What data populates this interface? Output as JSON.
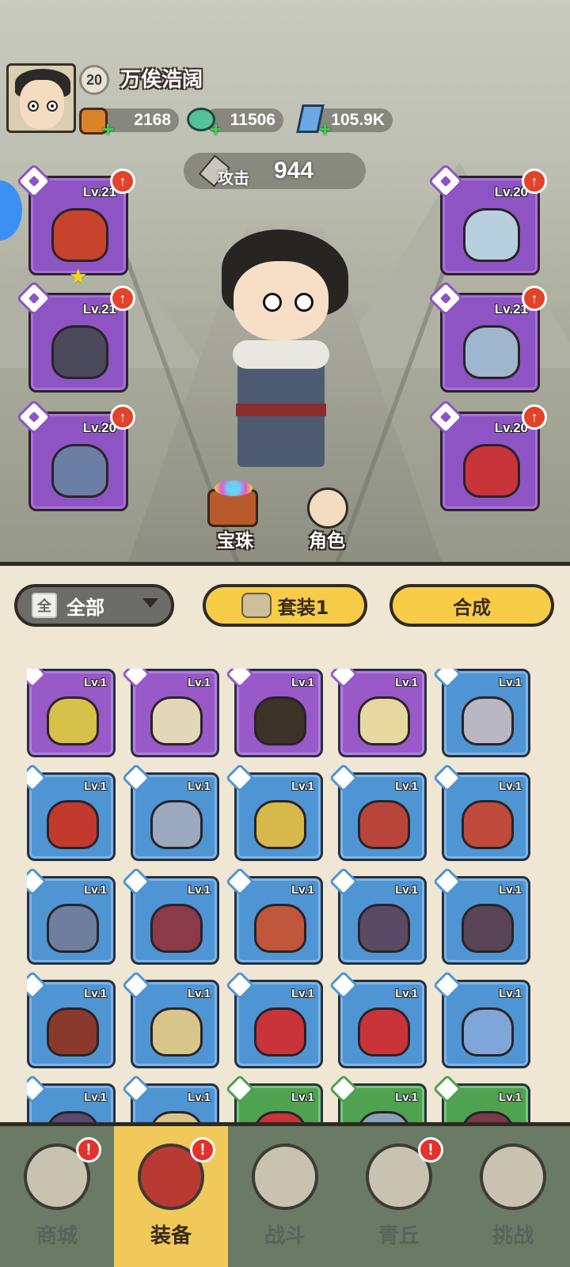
{
  "player": {
    "level": "20",
    "name": "万俟浩阔"
  },
  "resources": [
    {
      "icon": "gold-bag-icon",
      "value": "2168"
    },
    {
      "icon": "jade-dragon-icon",
      "value": "11506"
    },
    {
      "icon": "crystal-icon",
      "value": "105.9K"
    }
  ],
  "attack": {
    "label": "攻击",
    "value": "944"
  },
  "equipped_left": [
    {
      "slot": "weapon",
      "level": "Lv.21",
      "upgrade": true,
      "star": true,
      "color": "#c8432e"
    },
    {
      "slot": "armor",
      "level": "Lv.21",
      "upgrade": true,
      "color": "#4a4a5c"
    },
    {
      "slot": "ring",
      "level": "Lv.20",
      "upgrade": true,
      "color": "#6b7fa6"
    }
  ],
  "equipped_right": [
    {
      "slot": "belt",
      "level": "Lv.20",
      "upgrade": true,
      "color": "#b8cfe0"
    },
    {
      "slot": "boots",
      "level": "Lv.21",
      "upgrade": true,
      "color": "#9fb6cf"
    },
    {
      "slot": "amulet",
      "level": "Lv.20",
      "upgrade": true,
      "color": "#c8343a"
    }
  ],
  "scene_buttons": {
    "gems": "宝珠",
    "character": "角色"
  },
  "filters": {
    "all_icon": "全",
    "all_label": "全部",
    "set_label": "套装1",
    "synth_label": "合成"
  },
  "inventory": [
    {
      "rarity": "p",
      "level": "Lv.1",
      "color": "#d6c14a"
    },
    {
      "rarity": "p",
      "level": "Lv.1",
      "color": "#e2d8b8"
    },
    {
      "rarity": "p",
      "level": "Lv.1",
      "color": "#3d3328"
    },
    {
      "rarity": "p",
      "level": "Lv.1",
      "color": "#e6d9a0"
    },
    {
      "rarity": "b",
      "level": "Lv.1",
      "color": "#b8b7c2"
    },
    {
      "rarity": "b",
      "level": "Lv.1",
      "color": "#c23a2e"
    },
    {
      "rarity": "b",
      "level": "Lv.1",
      "color": "#9aa9bd"
    },
    {
      "rarity": "b",
      "level": "Lv.1",
      "color": "#d7b84a"
    },
    {
      "rarity": "b",
      "level": "Lv.1",
      "color": "#b8453a"
    },
    {
      "rarity": "b",
      "level": "Lv.1",
      "color": "#c04a3c"
    },
    {
      "rarity": "b",
      "level": "Lv.1",
      "color": "#6e7f9e"
    },
    {
      "rarity": "b",
      "level": "Lv.1",
      "color": "#8a3a48"
    },
    {
      "rarity": "b",
      "level": "Lv.1",
      "color": "#c0563a"
    },
    {
      "rarity": "b",
      "level": "Lv.1",
      "color": "#5a4a66"
    },
    {
      "rarity": "b",
      "level": "Lv.1",
      "color": "#5a4556"
    },
    {
      "rarity": "b",
      "level": "Lv.1",
      "color": "#8a3a2c"
    },
    {
      "rarity": "b",
      "level": "Lv.1",
      "color": "#d8c58a"
    },
    {
      "rarity": "b",
      "level": "Lv.1",
      "color": "#c8343a"
    },
    {
      "rarity": "b",
      "level": "Lv.1",
      "color": "#c8343a"
    },
    {
      "rarity": "b",
      "level": "Lv.1",
      "color": "#7fa6d8"
    },
    {
      "rarity": "b",
      "level": "Lv.1",
      "color": "#5a4a70"
    },
    {
      "rarity": "b",
      "level": "Lv.1",
      "color": "#d8c58a"
    },
    {
      "rarity": "g",
      "level": "Lv.1",
      "color": "#c8343a"
    },
    {
      "rarity": "g",
      "level": "Lv.1",
      "color": "#8aa2b8"
    },
    {
      "rarity": "g",
      "level": "Lv.1",
      "color": "#7a3a4a"
    }
  ],
  "nav": [
    {
      "label": "商城",
      "badge": "!",
      "active": false
    },
    {
      "label": "装备",
      "badge": "!",
      "active": true
    },
    {
      "label": "战斗",
      "badge": "",
      "active": false
    },
    {
      "label": "青丘",
      "badge": "!",
      "active": false
    },
    {
      "label": "挑战",
      "badge": "",
      "active": false
    }
  ]
}
